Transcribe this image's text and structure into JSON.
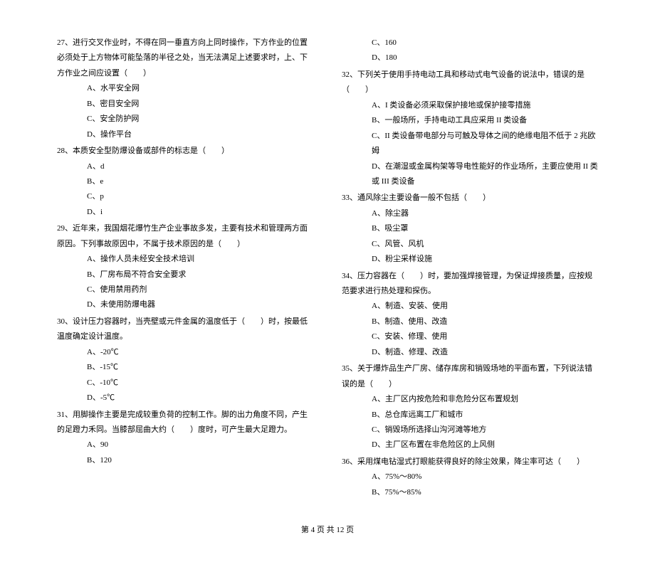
{
  "left": {
    "q27": {
      "text": "27、进行交叉作业时，不得在同一垂直方向上同时操作，下方作业的位置必须处于上方物体可能坠落的半径之处，当无法满足上述要求时，上、下方作业之间应设置（　　）",
      "a": "A、水平安全网",
      "b": "B、密目安全网",
      "c": "C、安全防护网",
      "d": "D、操作平台"
    },
    "q28": {
      "text": "28、本质安全型防爆设备或部件的标志是（　　）",
      "a": "A、d",
      "b": "B、e",
      "c": "C、p",
      "d": "D、i"
    },
    "q29": {
      "text": "29、近年来，我国烟花爆竹生产企业事故多发，主要有技术和管理两方面原因。下列事故原因中，不属于技术原因的是（　　）",
      "a": "A、操作人员未经安全技术培训",
      "b": "B、厂房布局不符合安全要求",
      "c": "C、使用禁用药剂",
      "d": "D、未使用防爆电器"
    },
    "q30": {
      "text": "30、设计压力容器时，当壳壁或元件金属的温度低于（　　）时，按最低温度确定设计温度。",
      "a": "A、-20℃",
      "b": "B、-15℃",
      "c": "C、-10℃",
      "d": "D、-5℃"
    },
    "q31": {
      "text": "31、用脚操作主要是完成较重负荷的控制工作。脚的出力角度不同，产生的足蹬力禾同。当膝部屈曲大约（　　）度时，可产生最大足蹬力。",
      "a": "A、90",
      "b": "B、120"
    }
  },
  "right": {
    "q31cont": {
      "c": "C、160",
      "d": "D、180"
    },
    "q32": {
      "text": "32、下列关于使用手持电动工具和移动式电气设备的说法中，错误的是（　　）",
      "a": "A、I 类设备必须采取保护接地或保护接零措施",
      "b": "B、一般场所，手持电动工具应采用 II 类设备",
      "c": "C、II 类设备带电部分与可触及导体之间的绝缘电阻不低于 2 兆欧姆",
      "d": "D、在潮湿或金属构架等导电性能好的作业场所，主要应使用 II 类或 III 类设备"
    },
    "q33": {
      "text": "33、通风除尘主要设备一般不包括（　　）",
      "a": "A、除尘器",
      "b": "B、吸尘罩",
      "c": "C、风管、风机",
      "d": "D、粉尘采样设施"
    },
    "q34": {
      "text": "34、压力容器在（　　）时，要加强焊接管理，为保证焊接质量，应按规范要求进行热处理和探伤。",
      "a": "A、制造、安装、使用",
      "b": "B、制造、使用、改造",
      "c": "C、安装、修理、使用",
      "d": "D、制造、修理、改造"
    },
    "q35": {
      "text": "35、关于爆炸品生产厂房、储存库房和销毁场地的平面布置，下列说法错误的是（　　）",
      "a": "A、主厂区内按危险和非危险分区布置规划",
      "b": "B、总仓库远离工厂和城市",
      "c": "C、销毁场所选择山沟河滩等地方",
      "d": "D、主厂区布置在非危险区的上风侧"
    },
    "q36": {
      "text": "36、采用煤电钻湿式打眼能获得良好的除尘效果，降尘率可达（　　）",
      "a": "A、75%～80%",
      "b": "B、75%～85%"
    }
  },
  "footer": "第 4 页 共 12 页"
}
